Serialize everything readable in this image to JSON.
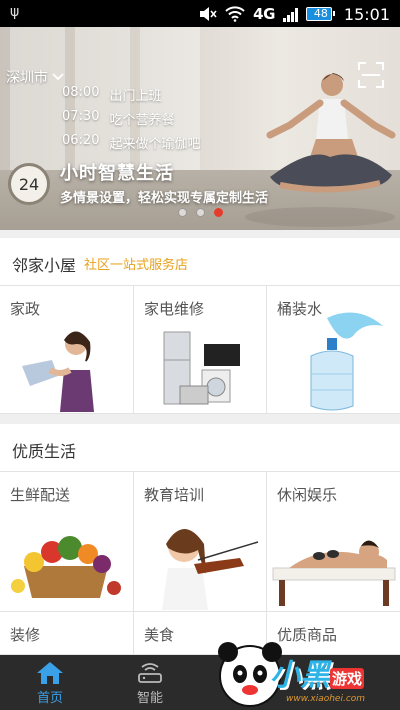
{
  "status": {
    "network": "4G",
    "battery": "48",
    "time": "15:01"
  },
  "banner": {
    "city": "深圳市",
    "schedule": [
      {
        "time": "08:00",
        "text": "出门上班"
      },
      {
        "time": "07:30",
        "text": "吃个营养餐"
      },
      {
        "time": "06:20",
        "text": "起来做个瑜伽吧"
      }
    ],
    "badge": "24",
    "title": "小时智慧生活",
    "subtitle": "多情景设置，轻松实现专属定制生活",
    "active_dot": 3
  },
  "neighbor": {
    "heading": "邻家小屋",
    "tag": "社区一站式服务店",
    "items": [
      {
        "label": "家政",
        "icon": "housekeeper-image"
      },
      {
        "label": "家电维修",
        "icon": "appliances-image"
      },
      {
        "label": "桶装水",
        "icon": "water-bottle-image"
      }
    ]
  },
  "quality": {
    "heading": "优质生活",
    "items": [
      {
        "label": "生鲜配送",
        "icon": "fresh-produce-image"
      },
      {
        "label": "教育培训",
        "icon": "violin-girl-image"
      },
      {
        "label": "休闲娱乐",
        "icon": "spa-massage-image"
      },
      {
        "label": "装修"
      },
      {
        "label": "美食"
      },
      {
        "label": "优质商品"
      }
    ]
  },
  "tabs": [
    {
      "label": "首页",
      "icon": "home-icon",
      "active": true
    },
    {
      "label": "智能",
      "icon": "router-icon",
      "active": false
    }
  ],
  "watermark": {
    "text": "小黑",
    "text2": "游戏",
    "url": "www.xiaohei.com"
  },
  "colors": {
    "accent": "#3aa0e8",
    "tag": "#e8a11c",
    "dot_active": "#e53b2c",
    "tabbar": "#2b2b2b"
  }
}
